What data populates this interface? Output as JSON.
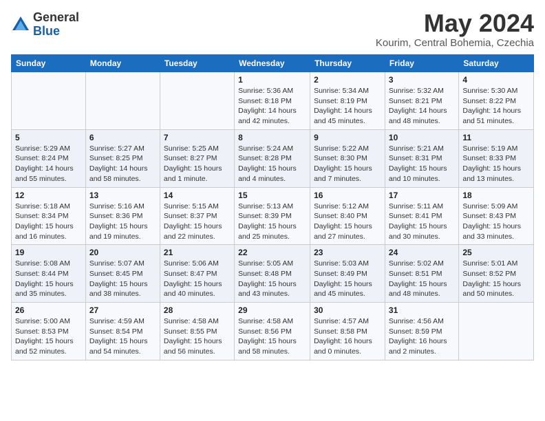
{
  "logo": {
    "general": "General",
    "blue": "Blue"
  },
  "title": "May 2024",
  "location": "Kourim, Central Bohemia, Czechia",
  "days_header": [
    "Sunday",
    "Monday",
    "Tuesday",
    "Wednesday",
    "Thursday",
    "Friday",
    "Saturday"
  ],
  "weeks": [
    [
      {
        "day": "",
        "sunrise": "",
        "sunset": "",
        "daylight": ""
      },
      {
        "day": "",
        "sunrise": "",
        "sunset": "",
        "daylight": ""
      },
      {
        "day": "",
        "sunrise": "",
        "sunset": "",
        "daylight": ""
      },
      {
        "day": "1",
        "sunrise": "Sunrise: 5:36 AM",
        "sunset": "Sunset: 8:18 PM",
        "daylight": "Daylight: 14 hours and 42 minutes."
      },
      {
        "day": "2",
        "sunrise": "Sunrise: 5:34 AM",
        "sunset": "Sunset: 8:19 PM",
        "daylight": "Daylight: 14 hours and 45 minutes."
      },
      {
        "day": "3",
        "sunrise": "Sunrise: 5:32 AM",
        "sunset": "Sunset: 8:21 PM",
        "daylight": "Daylight: 14 hours and 48 minutes."
      },
      {
        "day": "4",
        "sunrise": "Sunrise: 5:30 AM",
        "sunset": "Sunset: 8:22 PM",
        "daylight": "Daylight: 14 hours and 51 minutes."
      }
    ],
    [
      {
        "day": "5",
        "sunrise": "Sunrise: 5:29 AM",
        "sunset": "Sunset: 8:24 PM",
        "daylight": "Daylight: 14 hours and 55 minutes."
      },
      {
        "day": "6",
        "sunrise": "Sunrise: 5:27 AM",
        "sunset": "Sunset: 8:25 PM",
        "daylight": "Daylight: 14 hours and 58 minutes."
      },
      {
        "day": "7",
        "sunrise": "Sunrise: 5:25 AM",
        "sunset": "Sunset: 8:27 PM",
        "daylight": "Daylight: 15 hours and 1 minute."
      },
      {
        "day": "8",
        "sunrise": "Sunrise: 5:24 AM",
        "sunset": "Sunset: 8:28 PM",
        "daylight": "Daylight: 15 hours and 4 minutes."
      },
      {
        "day": "9",
        "sunrise": "Sunrise: 5:22 AM",
        "sunset": "Sunset: 8:30 PM",
        "daylight": "Daylight: 15 hours and 7 minutes."
      },
      {
        "day": "10",
        "sunrise": "Sunrise: 5:21 AM",
        "sunset": "Sunset: 8:31 PM",
        "daylight": "Daylight: 15 hours and 10 minutes."
      },
      {
        "day": "11",
        "sunrise": "Sunrise: 5:19 AM",
        "sunset": "Sunset: 8:33 PM",
        "daylight": "Daylight: 15 hours and 13 minutes."
      }
    ],
    [
      {
        "day": "12",
        "sunrise": "Sunrise: 5:18 AM",
        "sunset": "Sunset: 8:34 PM",
        "daylight": "Daylight: 15 hours and 16 minutes."
      },
      {
        "day": "13",
        "sunrise": "Sunrise: 5:16 AM",
        "sunset": "Sunset: 8:36 PM",
        "daylight": "Daylight: 15 hours and 19 minutes."
      },
      {
        "day": "14",
        "sunrise": "Sunrise: 5:15 AM",
        "sunset": "Sunset: 8:37 PM",
        "daylight": "Daylight: 15 hours and 22 minutes."
      },
      {
        "day": "15",
        "sunrise": "Sunrise: 5:13 AM",
        "sunset": "Sunset: 8:39 PM",
        "daylight": "Daylight: 15 hours and 25 minutes."
      },
      {
        "day": "16",
        "sunrise": "Sunrise: 5:12 AM",
        "sunset": "Sunset: 8:40 PM",
        "daylight": "Daylight: 15 hours and 27 minutes."
      },
      {
        "day": "17",
        "sunrise": "Sunrise: 5:11 AM",
        "sunset": "Sunset: 8:41 PM",
        "daylight": "Daylight: 15 hours and 30 minutes."
      },
      {
        "day": "18",
        "sunrise": "Sunrise: 5:09 AM",
        "sunset": "Sunset: 8:43 PM",
        "daylight": "Daylight: 15 hours and 33 minutes."
      }
    ],
    [
      {
        "day": "19",
        "sunrise": "Sunrise: 5:08 AM",
        "sunset": "Sunset: 8:44 PM",
        "daylight": "Daylight: 15 hours and 35 minutes."
      },
      {
        "day": "20",
        "sunrise": "Sunrise: 5:07 AM",
        "sunset": "Sunset: 8:45 PM",
        "daylight": "Daylight: 15 hours and 38 minutes."
      },
      {
        "day": "21",
        "sunrise": "Sunrise: 5:06 AM",
        "sunset": "Sunset: 8:47 PM",
        "daylight": "Daylight: 15 hours and 40 minutes."
      },
      {
        "day": "22",
        "sunrise": "Sunrise: 5:05 AM",
        "sunset": "Sunset: 8:48 PM",
        "daylight": "Daylight: 15 hours and 43 minutes."
      },
      {
        "day": "23",
        "sunrise": "Sunrise: 5:03 AM",
        "sunset": "Sunset: 8:49 PM",
        "daylight": "Daylight: 15 hours and 45 minutes."
      },
      {
        "day": "24",
        "sunrise": "Sunrise: 5:02 AM",
        "sunset": "Sunset: 8:51 PM",
        "daylight": "Daylight: 15 hours and 48 minutes."
      },
      {
        "day": "25",
        "sunrise": "Sunrise: 5:01 AM",
        "sunset": "Sunset: 8:52 PM",
        "daylight": "Daylight: 15 hours and 50 minutes."
      }
    ],
    [
      {
        "day": "26",
        "sunrise": "Sunrise: 5:00 AM",
        "sunset": "Sunset: 8:53 PM",
        "daylight": "Daylight: 15 hours and 52 minutes."
      },
      {
        "day": "27",
        "sunrise": "Sunrise: 4:59 AM",
        "sunset": "Sunset: 8:54 PM",
        "daylight": "Daylight: 15 hours and 54 minutes."
      },
      {
        "day": "28",
        "sunrise": "Sunrise: 4:58 AM",
        "sunset": "Sunset: 8:55 PM",
        "daylight": "Daylight: 15 hours and 56 minutes."
      },
      {
        "day": "29",
        "sunrise": "Sunrise: 4:58 AM",
        "sunset": "Sunset: 8:56 PM",
        "daylight": "Daylight: 15 hours and 58 minutes."
      },
      {
        "day": "30",
        "sunrise": "Sunrise: 4:57 AM",
        "sunset": "Sunset: 8:58 PM",
        "daylight": "Daylight: 16 hours and 0 minutes."
      },
      {
        "day": "31",
        "sunrise": "Sunrise: 4:56 AM",
        "sunset": "Sunset: 8:59 PM",
        "daylight": "Daylight: 16 hours and 2 minutes."
      },
      {
        "day": "",
        "sunrise": "",
        "sunset": "",
        "daylight": ""
      }
    ]
  ]
}
